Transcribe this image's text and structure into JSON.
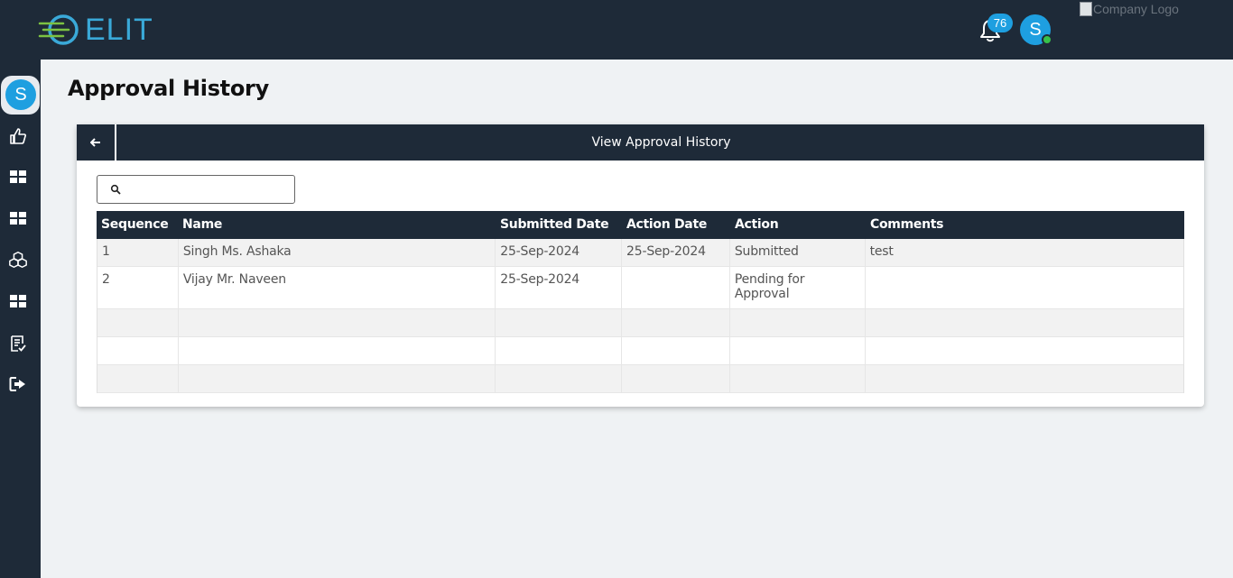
{
  "header": {
    "brand": "ELIT",
    "notification_count": "76",
    "user_initial": "S",
    "company_logo_alt": "Company Logo"
  },
  "sidebar": {
    "user_initial": "S",
    "items": [
      {
        "icon": "thumbs-up-icon"
      },
      {
        "icon": "dashboard-icon"
      },
      {
        "icon": "dashboard-icon"
      },
      {
        "icon": "cubes-icon"
      },
      {
        "icon": "dashboard-icon"
      },
      {
        "icon": "task-list-icon"
      },
      {
        "icon": "logout-icon"
      }
    ]
  },
  "page": {
    "title": "Approval History",
    "card_title": "View Approval History",
    "search_placeholder": ""
  },
  "table": {
    "columns": [
      "Sequence",
      "Name",
      "Submitted Date",
      "Action Date",
      "Action",
      "Comments"
    ],
    "rows": [
      {
        "sequence": "1",
        "name": "Singh Ms. Ashaka",
        "submitted": "25-Sep-2024",
        "action_date": "25-Sep-2024",
        "action": "Submitted",
        "comments": "test"
      },
      {
        "sequence": "2",
        "name": "Vijay Mr. Naveen",
        "submitted": "25-Sep-2024",
        "action_date": "",
        "action": "Pending for Approval",
        "comments": ""
      },
      {
        "sequence": "",
        "name": "",
        "submitted": "",
        "action_date": "",
        "action": "",
        "comments": ""
      },
      {
        "sequence": "",
        "name": "",
        "submitted": "",
        "action_date": "",
        "action": "",
        "comments": ""
      },
      {
        "sequence": "",
        "name": "",
        "submitted": "",
        "action_date": "",
        "action": "",
        "comments": ""
      }
    ]
  },
  "colors": {
    "navy": "#1e2a38",
    "accent": "#1e9fe0",
    "online": "#38c24a",
    "background": "#eff2f4"
  }
}
